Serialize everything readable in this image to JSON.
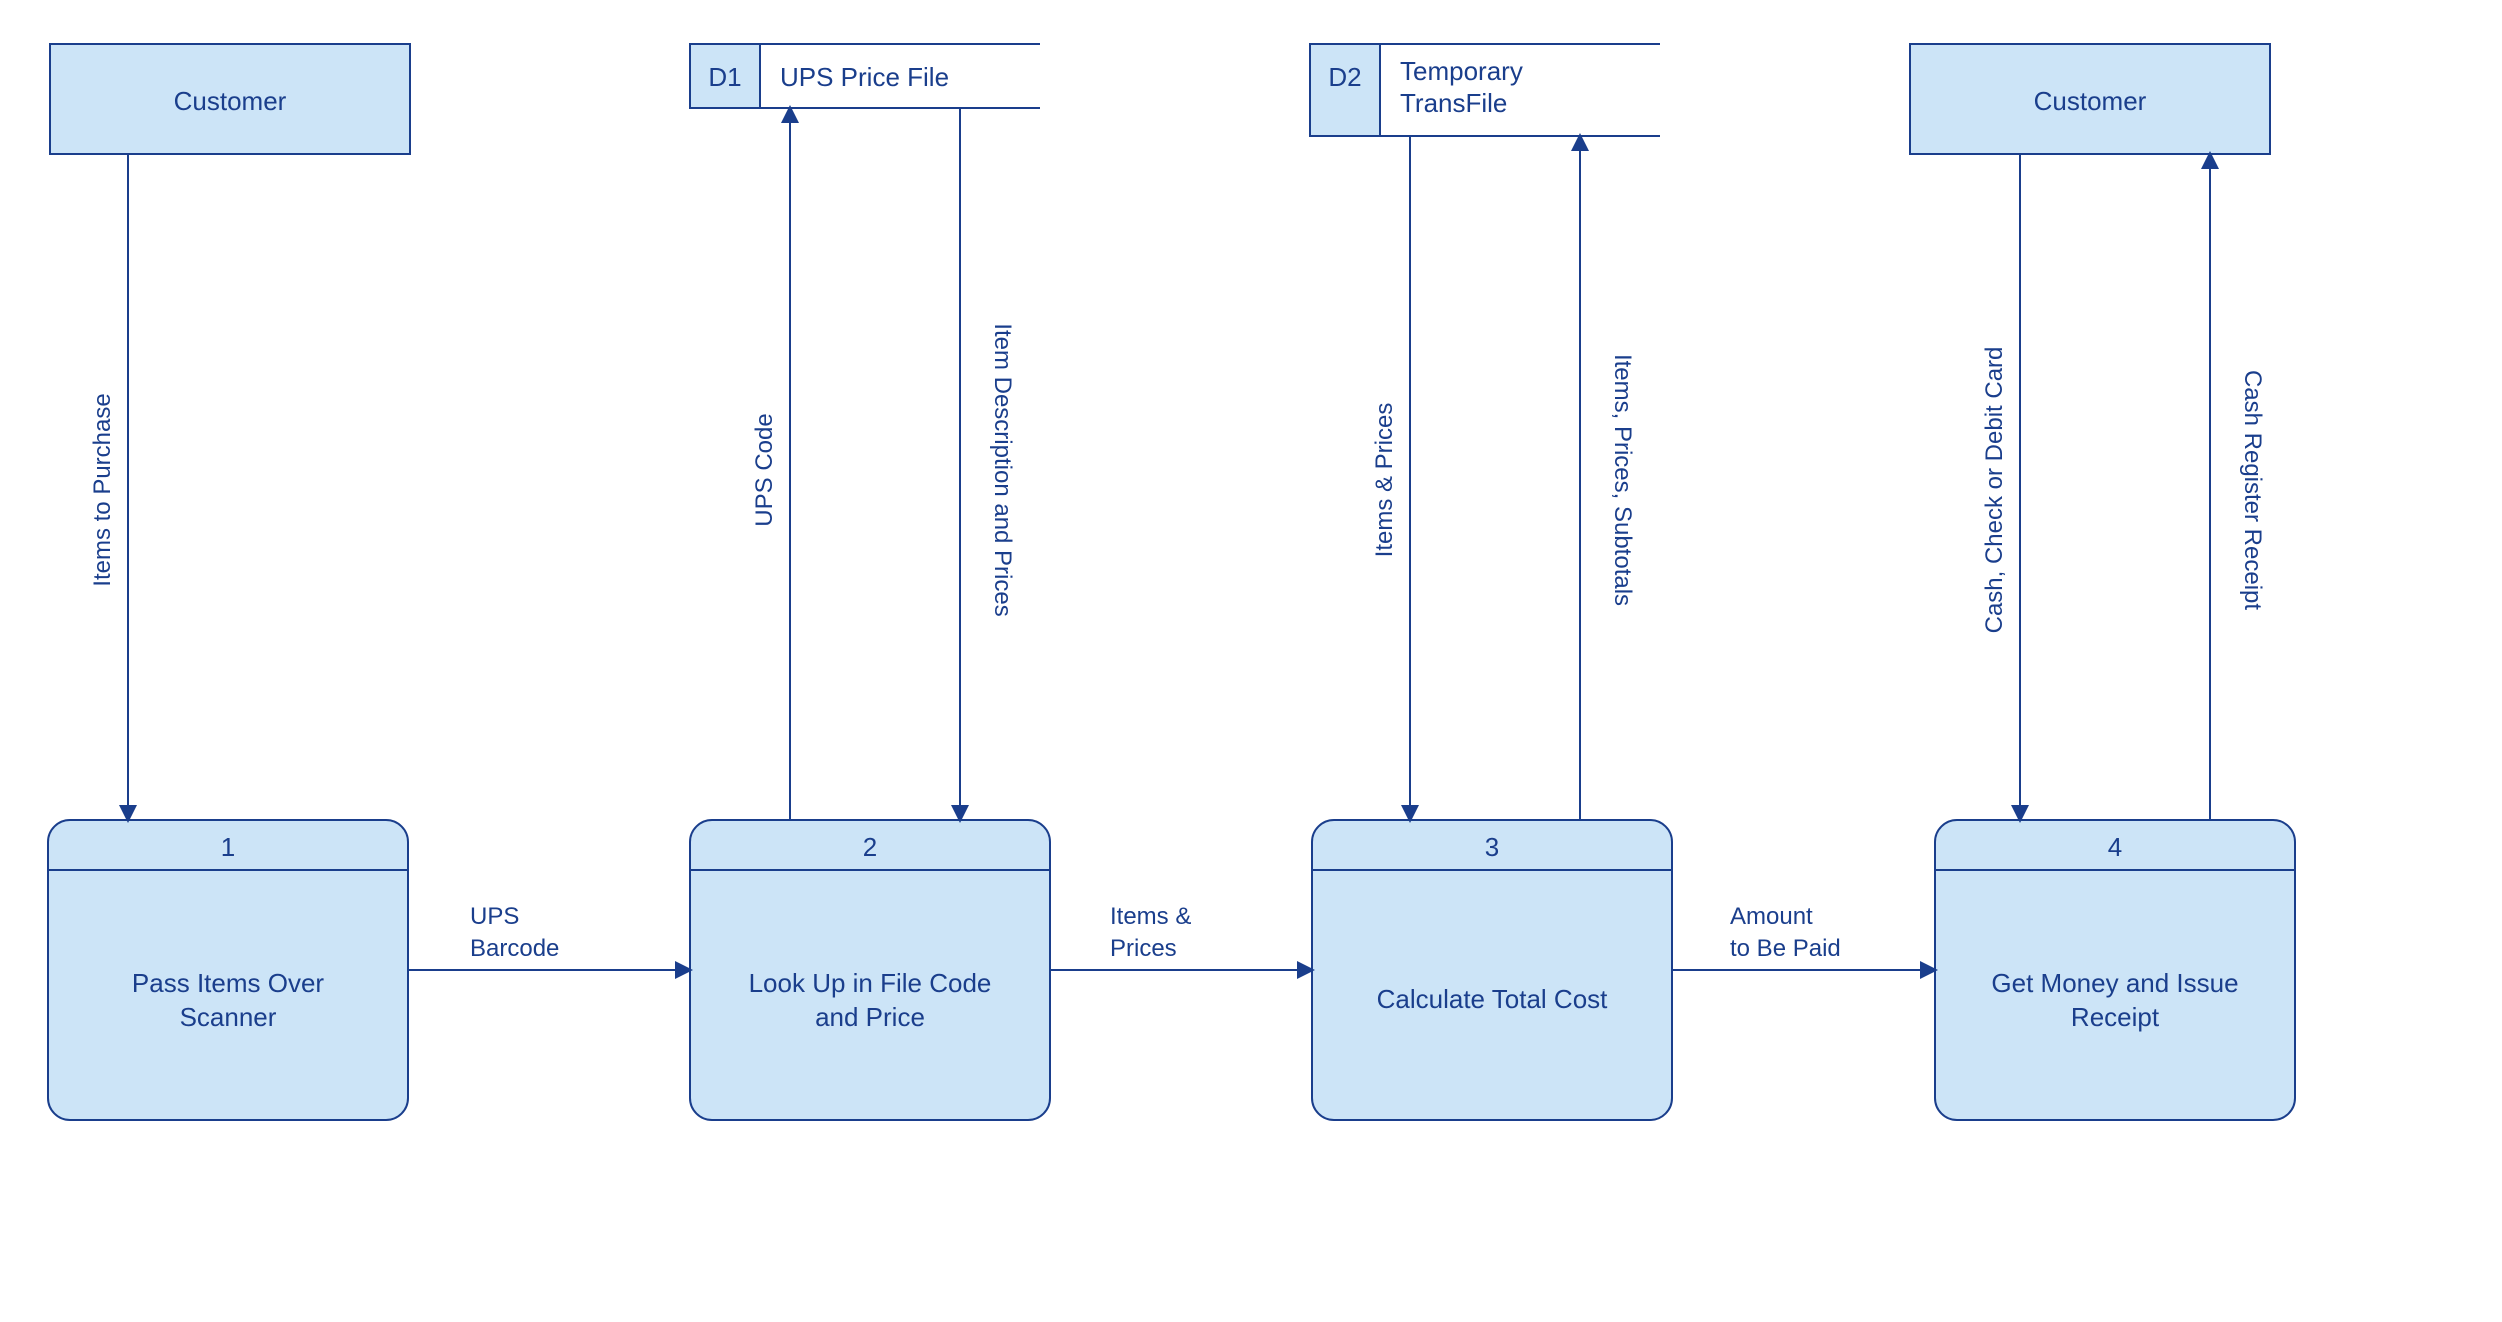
{
  "entities": {
    "customer_left": "Customer",
    "customer_right": "Customer"
  },
  "datastores": {
    "d1_id": "D1",
    "d1_label": "UPS Price File",
    "d2_id": "D2",
    "d2_label_line1": "Temporary",
    "d2_label_line2": "TransFile"
  },
  "processes": {
    "p1_num": "1",
    "p1_label_line1": "Pass Items Over",
    "p1_label_line2": "Scanner",
    "p2_num": "2",
    "p2_label_line1": "Look Up in File Code",
    "p2_label_line2": "and Price",
    "p3_num": "3",
    "p3_label": "Calculate Total Cost",
    "p4_num": "4",
    "p4_label_line1": "Get Money and Issue",
    "p4_label_line2": "Receipt"
  },
  "flows": {
    "items_to_purchase": "Items to Purchase",
    "ups_code": "UPS Code",
    "item_desc_prices": "Item Description and Prices",
    "items_prices_v": "Items & Prices",
    "items_prices_sub": "Items, Prices, Subtotals",
    "cash_check_debit": "Cash, Check or Debit Card",
    "cash_register_receipt": "Cash Register Receipt",
    "ups_barcode_line1": "UPS",
    "ups_barcode_line2": "Barcode",
    "items_prices_h_line1": "Items &",
    "items_prices_h_line2": "Prices",
    "amount_paid_line1": "Amount",
    "amount_paid_line2": "to Be Paid"
  }
}
